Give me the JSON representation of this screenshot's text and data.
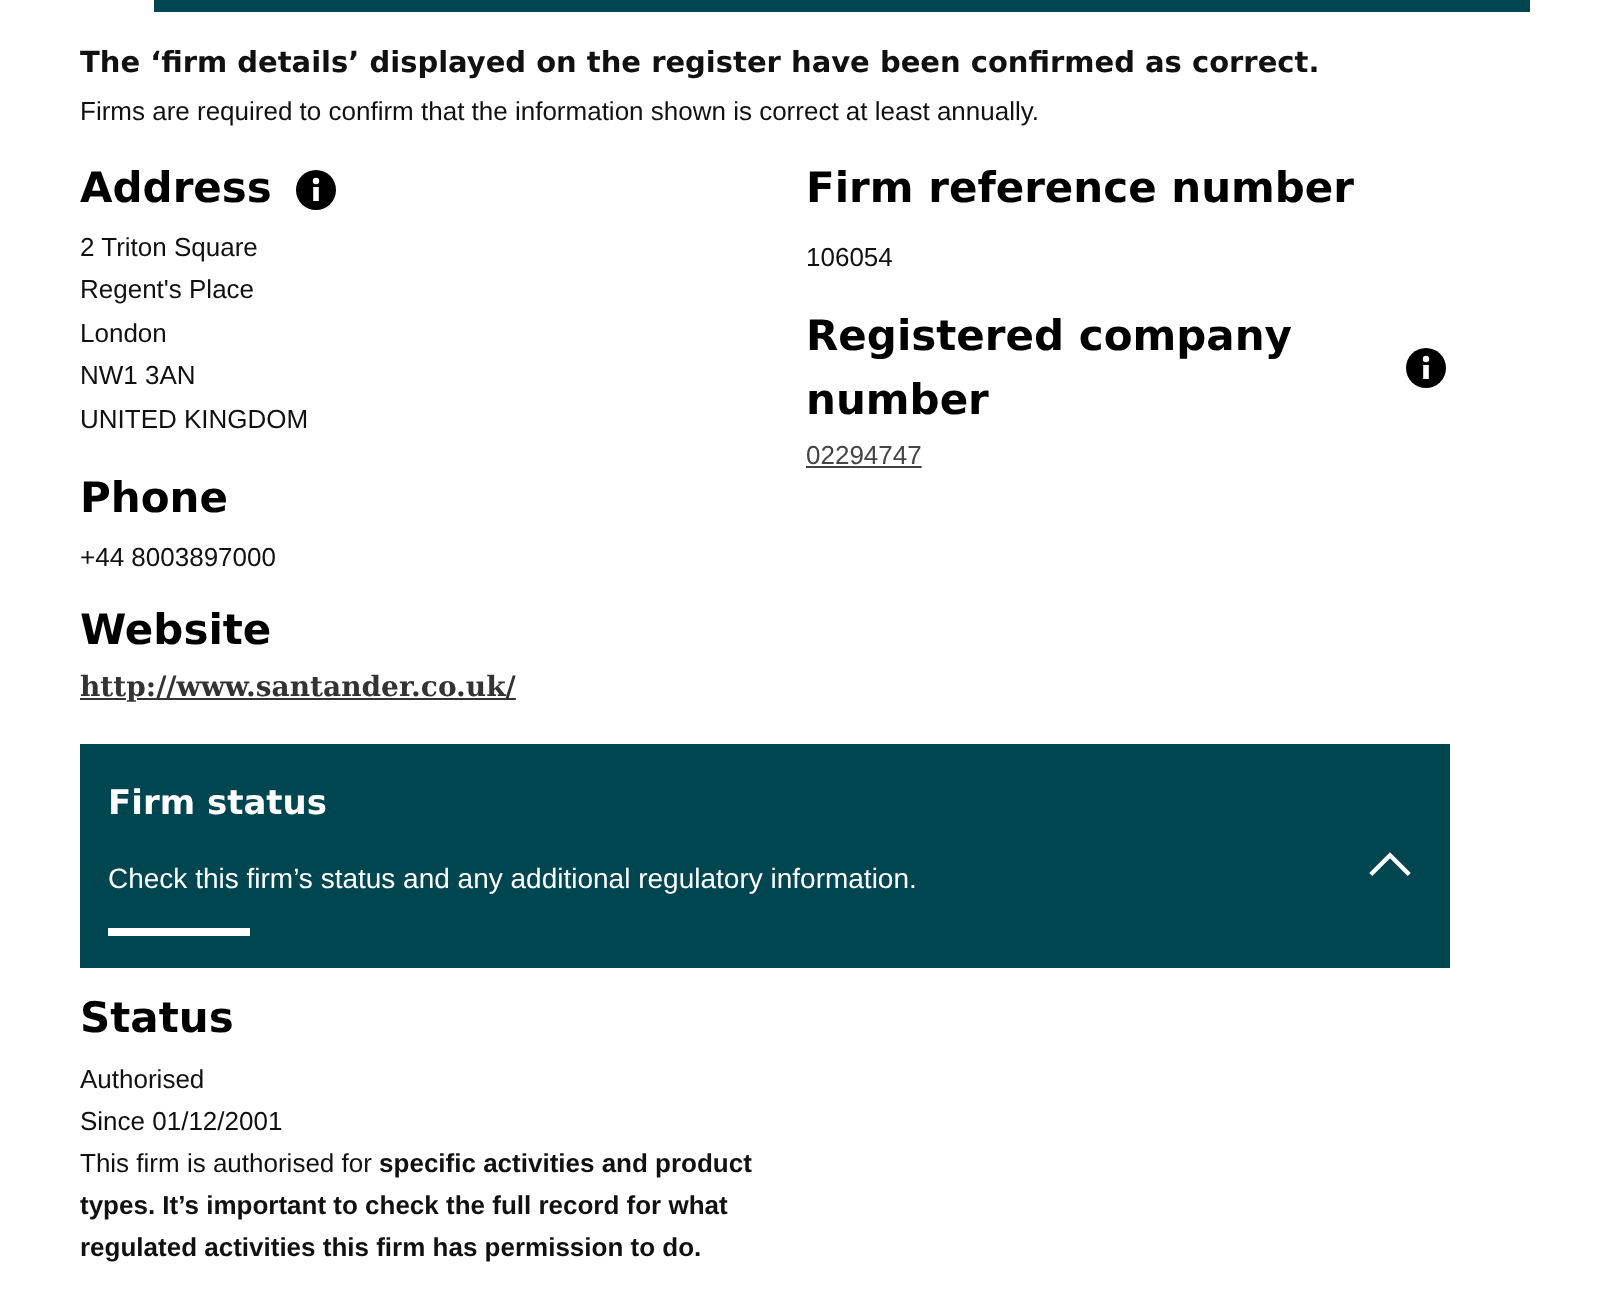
{
  "notice": {
    "title": "The ‘firm details’ displayed on the register have been confirmed as correct.",
    "text": "Firms are required to confirm that the information shown is correct at least annually."
  },
  "address": {
    "heading": "Address",
    "lines": [
      "2 Triton Square",
      "Regent's Place",
      "London",
      "NW1 3AN",
      "UNITED KINGDOM"
    ]
  },
  "phone": {
    "heading": "Phone",
    "value": "+44 8003897000"
  },
  "website": {
    "heading": "Website",
    "link": "http://www.santander.co.uk/"
  },
  "firm_reference": {
    "heading": "Firm reference number",
    "value": "106054"
  },
  "company_number": {
    "heading": "Registered company number",
    "link": "02294747"
  },
  "firm_status_panel": {
    "title": "Firm status",
    "text": "Check this firm’s status and any additional regulatory information.",
    "expanded": true
  },
  "status": {
    "heading": "Status",
    "lines": [
      "Authorised",
      "Since 01/12/2001"
    ],
    "description": "This firm is authorised for **specific activities and product types. It’s important to check the full record for what regulated activities this firm has permission to do.**"
  }
}
